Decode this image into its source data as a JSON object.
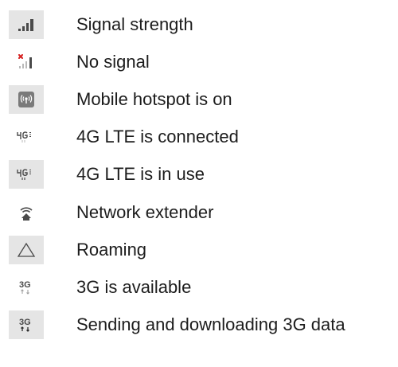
{
  "items": [
    {
      "icon": "signal-strength-icon",
      "label": "Signal strength"
    },
    {
      "icon": "no-signal-icon",
      "label": "No signal"
    },
    {
      "icon": "mobile-hotspot-icon",
      "label": "Mobile hotspot is on"
    },
    {
      "icon": "4g-lte-connected-icon",
      "label": "4G LTE is connected"
    },
    {
      "icon": "4g-lte-in-use-icon",
      "label": "4G LTE is in use"
    },
    {
      "icon": "network-extender-icon",
      "label": "Network extender"
    },
    {
      "icon": "roaming-icon",
      "label": "Roaming"
    },
    {
      "icon": "3g-available-icon",
      "label": "3G is available"
    },
    {
      "icon": "3g-data-transfer-icon",
      "label": "Sending and downloading 3G data"
    }
  ],
  "colors": {
    "icon_background": "#e5e5e5",
    "no_signal_mark": "#d62020",
    "icon_glyph": "#4a4a4a"
  }
}
